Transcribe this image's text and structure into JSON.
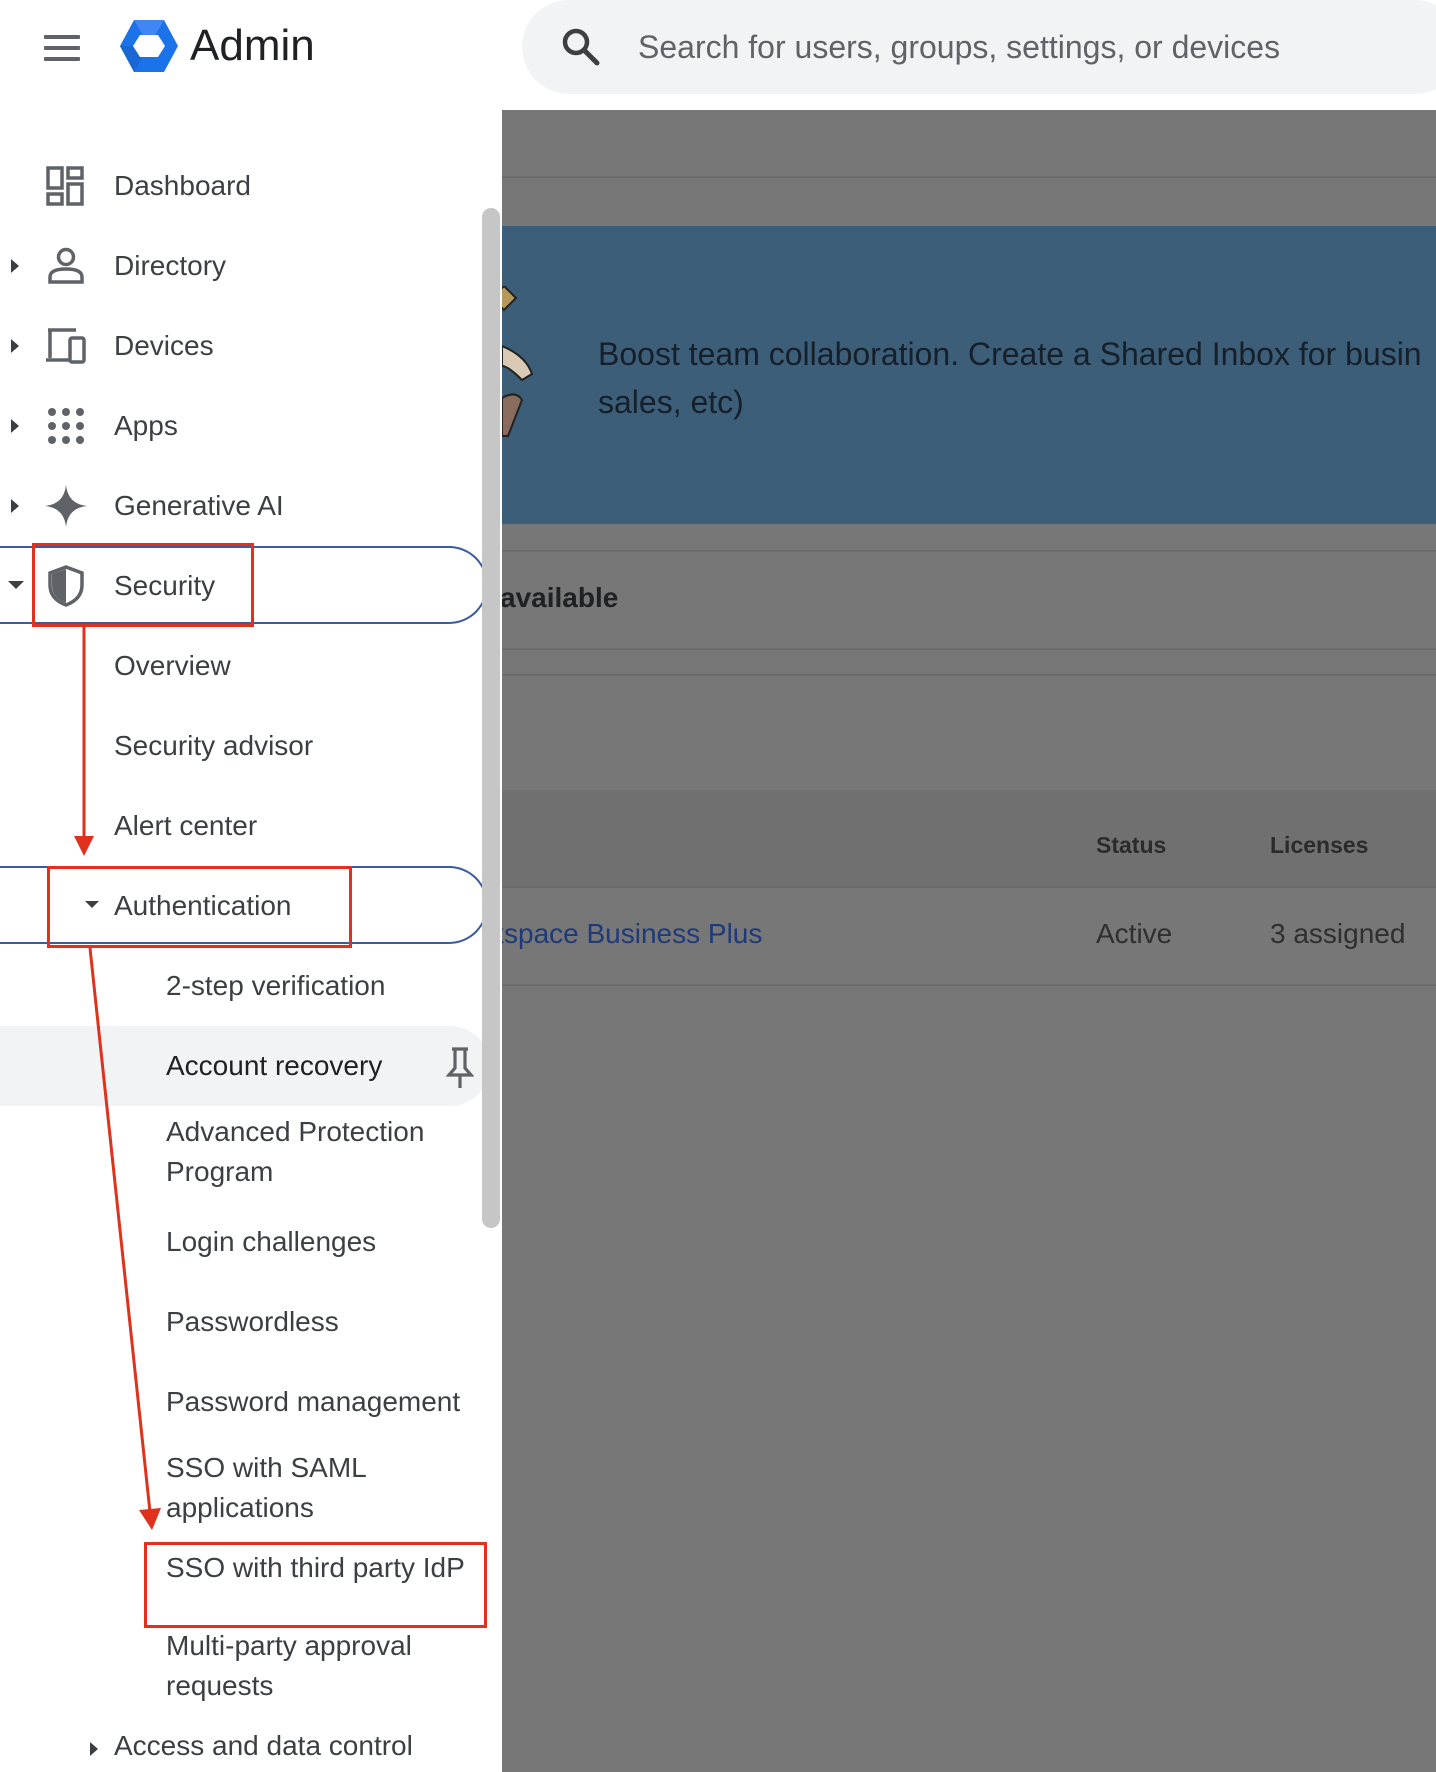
{
  "header": {
    "app_title": "Admin",
    "search_placeholder": "Search for users, groups, settings, or devices",
    "menu_icon": "hamburger-menu-icon",
    "logo_icon": "google-admin-hexagon-logo",
    "search_icon": "magnifier-icon"
  },
  "sidebar": {
    "items": [
      {
        "label": "Dashboard",
        "icon": "dashboard-icon"
      },
      {
        "label": "Directory",
        "icon": "person-icon"
      },
      {
        "label": "Devices",
        "icon": "devices-icon"
      },
      {
        "label": "Apps",
        "icon": "apps-grid-icon"
      },
      {
        "label": "Generative AI",
        "icon": "sparkle-icon"
      },
      {
        "label": "Security",
        "icon": "shield-icon"
      }
    ],
    "security_children": [
      "Overview",
      "Security advisor",
      "Alert center"
    ],
    "authentication": {
      "label": "Authentication",
      "children": [
        "2-step verification",
        "Account recovery",
        "Advanced Protection Program",
        "Login challenges",
        "Passwordless",
        "Password management",
        "SSO with SAML applications",
        "SSO with third party IdP",
        "Multi-party approval requests"
      ]
    },
    "access_and_data_control": "Access and data control"
  },
  "main": {
    "banner_text": "Boost team collaboration. Create a Shared Inbox for busin sales, etc)",
    "section_title": "available",
    "table": {
      "headers": [
        "Status",
        "Licenses"
      ],
      "rows": [
        {
          "product": "kspace Business Plus",
          "status": "Active",
          "licenses": "3 assigned"
        }
      ]
    }
  },
  "colors": {
    "annotation_red": "#e0311d",
    "selected_outline": "#3a5ba0",
    "overlay_gray": "#777777",
    "banner_blue": "#3d5e78",
    "logo_blue": "#1a73e8"
  }
}
